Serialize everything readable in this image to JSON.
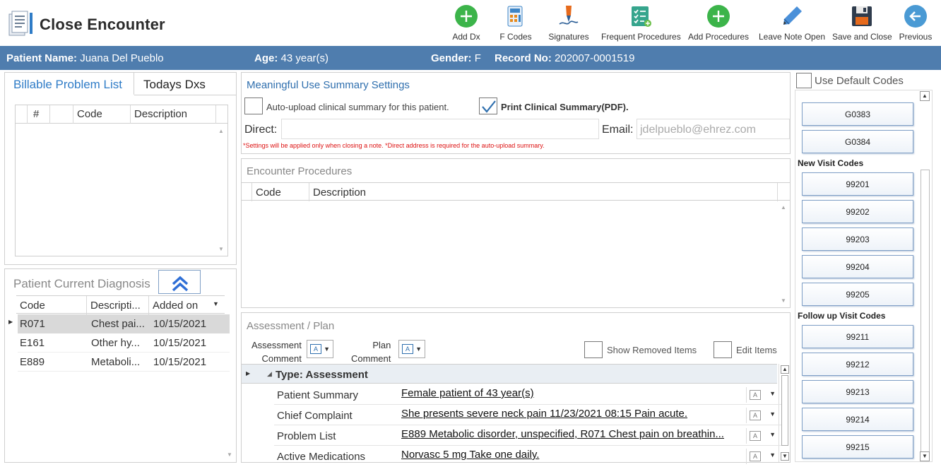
{
  "app": {
    "title": "Close Encounter"
  },
  "toolbar": [
    {
      "label": "Add Dx",
      "icon": "plus-circle-icon"
    },
    {
      "label": "F Codes",
      "icon": "calculator-icon"
    },
    {
      "label": "Signatures",
      "icon": "pen-icon"
    },
    {
      "label": "Frequent Procedures",
      "icon": "checklist-icon"
    },
    {
      "label": "Add Procedures",
      "icon": "plus-circle-icon"
    },
    {
      "label": "Leave Note Open",
      "icon": "pencil-icon"
    },
    {
      "label": "Save and Close",
      "icon": "floppy-icon"
    },
    {
      "label": "Previous",
      "icon": "back-arrow-icon"
    }
  ],
  "patient": {
    "name_label": "Patient Name:",
    "name": "Juana Del Pueblo",
    "age_label": "Age:",
    "age": "43 year(s)",
    "gender_label": "Gender:",
    "gender": "F",
    "record_label": "Record No:",
    "record": "202007-0001519"
  },
  "billable": {
    "tabs": [
      "Billable Problem List",
      "Todays Dxs"
    ],
    "columns": [
      "#",
      "Code",
      "Description"
    ]
  },
  "current_dx": {
    "title": "Patient Current Diagnosis",
    "columns": [
      "Code",
      "Descripti...",
      "Added on"
    ],
    "rows": [
      {
        "code": "R071",
        "desc": "Chest pai...",
        "date": "10/15/2021"
      },
      {
        "code": "E161",
        "desc": "Other hy...",
        "date": "10/15/2021"
      },
      {
        "code": "E889",
        "desc": "Metaboli...",
        "date": "10/15/2021"
      }
    ]
  },
  "mu": {
    "title": "Meaningful Use Summary Settings",
    "auto_upload_label": "Auto-upload clinical summary for this patient.",
    "print_label": "Print Clinical Summary(PDF).",
    "direct_label": "Direct:",
    "direct_value": "",
    "email_label": "Email:",
    "email_value": "jdelpueblo@ehrez.com",
    "note": "*Settings will be applied only when closing a note.   *Direct address is required for the auto-upload summary."
  },
  "procedures": {
    "title": "Encounter Procedures",
    "columns": [
      "Code",
      "Description"
    ]
  },
  "ap": {
    "title": "Assessment / Plan",
    "assessment_comment": "Assessment\nComment",
    "plan_comment": "Plan\nComment",
    "show_removed": "Show Removed Items",
    "edit_items": "Edit Items",
    "group": "Type: Assessment",
    "rows": [
      {
        "key": "Patient Summary",
        "value": "Female patient of 43 year(s)"
      },
      {
        "key": "Chief Complaint",
        "value": " She presents severe neck pain 11/23/2021 08:15 Pain acute. "
      },
      {
        "key": "Problem List",
        "value": "E889 Metabolic disorder, unspecified, R071 Chest pain on breathin..."
      },
      {
        "key": "Active Medications",
        "value": "Norvasc 5 mg Take one daily. "
      }
    ]
  },
  "codes": {
    "use_default": "Use Default Codes",
    "top": [
      "G0383",
      "G0384"
    ],
    "new_visit_header": "New Visit Codes",
    "new_visit": [
      "99201",
      "99202",
      "99203",
      "99204",
      "99205"
    ],
    "follow_up_header": "Follow up Visit Codes",
    "follow_up": [
      "99211",
      "99212",
      "99213",
      "99214",
      "99215"
    ]
  }
}
